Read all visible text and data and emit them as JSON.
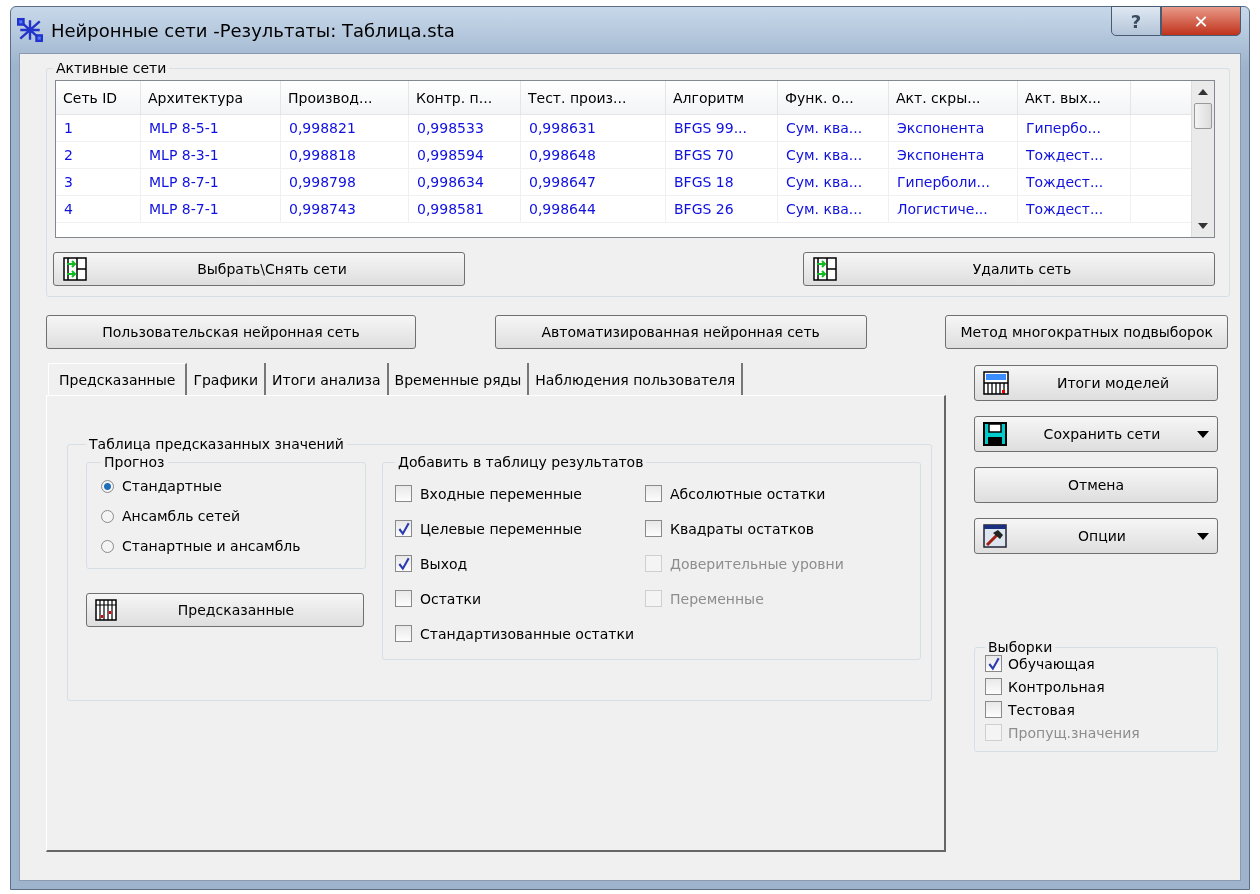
{
  "window": {
    "title": "Нейронные сети -Результаты: Таблица.sta",
    "help": "?",
    "close": "✕"
  },
  "active_networks": {
    "label": "Активные сети",
    "columns": [
      "Сеть ID",
      "Архитектура",
      "Производ...",
      "Контр. п...",
      "Тест. произ...",
      "Алгоритм",
      "Функ. о...",
      "Акт. скры...",
      "Акт. вых..."
    ],
    "rows": [
      [
        "1",
        "MLP 8-5-1",
        "0,998821",
        "0,998533",
        "0,998631",
        "BFGS 99...",
        "Сум. ква...",
        "Экспонента",
        "Гипербо..."
      ],
      [
        "2",
        "MLP 8-3-1",
        "0,998818",
        "0,998594",
        "0,998648",
        "BFGS 70",
        "Сум. ква...",
        "Экспонента",
        "Тождест..."
      ],
      [
        "3",
        "MLP 8-7-1",
        "0,998798",
        "0,998634",
        "0,998647",
        "BFGS 18",
        "Сум. ква...",
        "Гиперболи...",
        "Тождест..."
      ],
      [
        "4",
        "MLP 8-7-1",
        "0,998743",
        "0,998581",
        "0,998644",
        "BFGS 26",
        "Сум. ква...",
        "Логистиче...",
        "Тождест..."
      ]
    ],
    "buttons": [
      "Выбрать\\Снять сети",
      "Удалить сеть"
    ]
  },
  "model_buttons": [
    "Пользовательская нейронная сеть",
    "Автоматизированная нейронная сеть",
    "Метод многократных подвыборок"
  ],
  "tabs": [
    {
      "label": "Предсказанные",
      "selected": true
    },
    {
      "label": "Графики",
      "selected": false
    },
    {
      "label": "Итоги анализа",
      "selected": false
    },
    {
      "label": "Временные ряды",
      "selected": false
    },
    {
      "label": "Наблюдения пользователя",
      "selected": false
    }
  ],
  "predicted_table": {
    "label": "Таблица предсказанных значений",
    "forecast": {
      "label": "Прогноз",
      "options": [
        {
          "label": "Стандартные",
          "selected": true
        },
        {
          "label": "Ансамбль сетей",
          "selected": false
        },
        {
          "label": "Станартные и ансамбль",
          "selected": false
        }
      ]
    },
    "button": "Предсказанные",
    "add": {
      "label": "Добавить в таблицу результатов",
      "items": [
        {
          "label": "Входные переменные",
          "checked": false,
          "disabled": false
        },
        {
          "label": "Целевые переменные",
          "checked": true,
          "disabled": false
        },
        {
          "label": "Выход",
          "checked": true,
          "disabled": false
        },
        {
          "label": "Остатки",
          "checked": false,
          "disabled": false
        },
        {
          "label": "Стандартизованные остатки",
          "checked": false,
          "disabled": false
        },
        {
          "label": "Абсолютные остатки",
          "checked": false,
          "disabled": false
        },
        {
          "label": "Квадраты остатков",
          "checked": false,
          "disabled": false
        },
        {
          "label": "Доверительные уровни",
          "checked": false,
          "disabled": true
        },
        {
          "label": "Переменные",
          "checked": false,
          "disabled": true
        }
      ]
    }
  },
  "side_buttons": [
    {
      "label": "Итоги моделей",
      "kind": "summary",
      "dropdown": false
    },
    {
      "label": "Сохранить сети",
      "kind": "save",
      "dropdown": true
    },
    {
      "label": "Отмена",
      "kind": "plain",
      "dropdown": false
    },
    {
      "label": "Опции",
      "kind": "options",
      "dropdown": true
    }
  ],
  "samples": {
    "label": "Выборки",
    "items": [
      {
        "label": "Обучающая",
        "checked": true,
        "disabled": false
      },
      {
        "label": "Контрольная",
        "checked": false,
        "disabled": false
      },
      {
        "label": "Тестовая",
        "checked": false,
        "disabled": false
      },
      {
        "label": "Пропущ.значения",
        "checked": false,
        "disabled": true
      }
    ]
  }
}
